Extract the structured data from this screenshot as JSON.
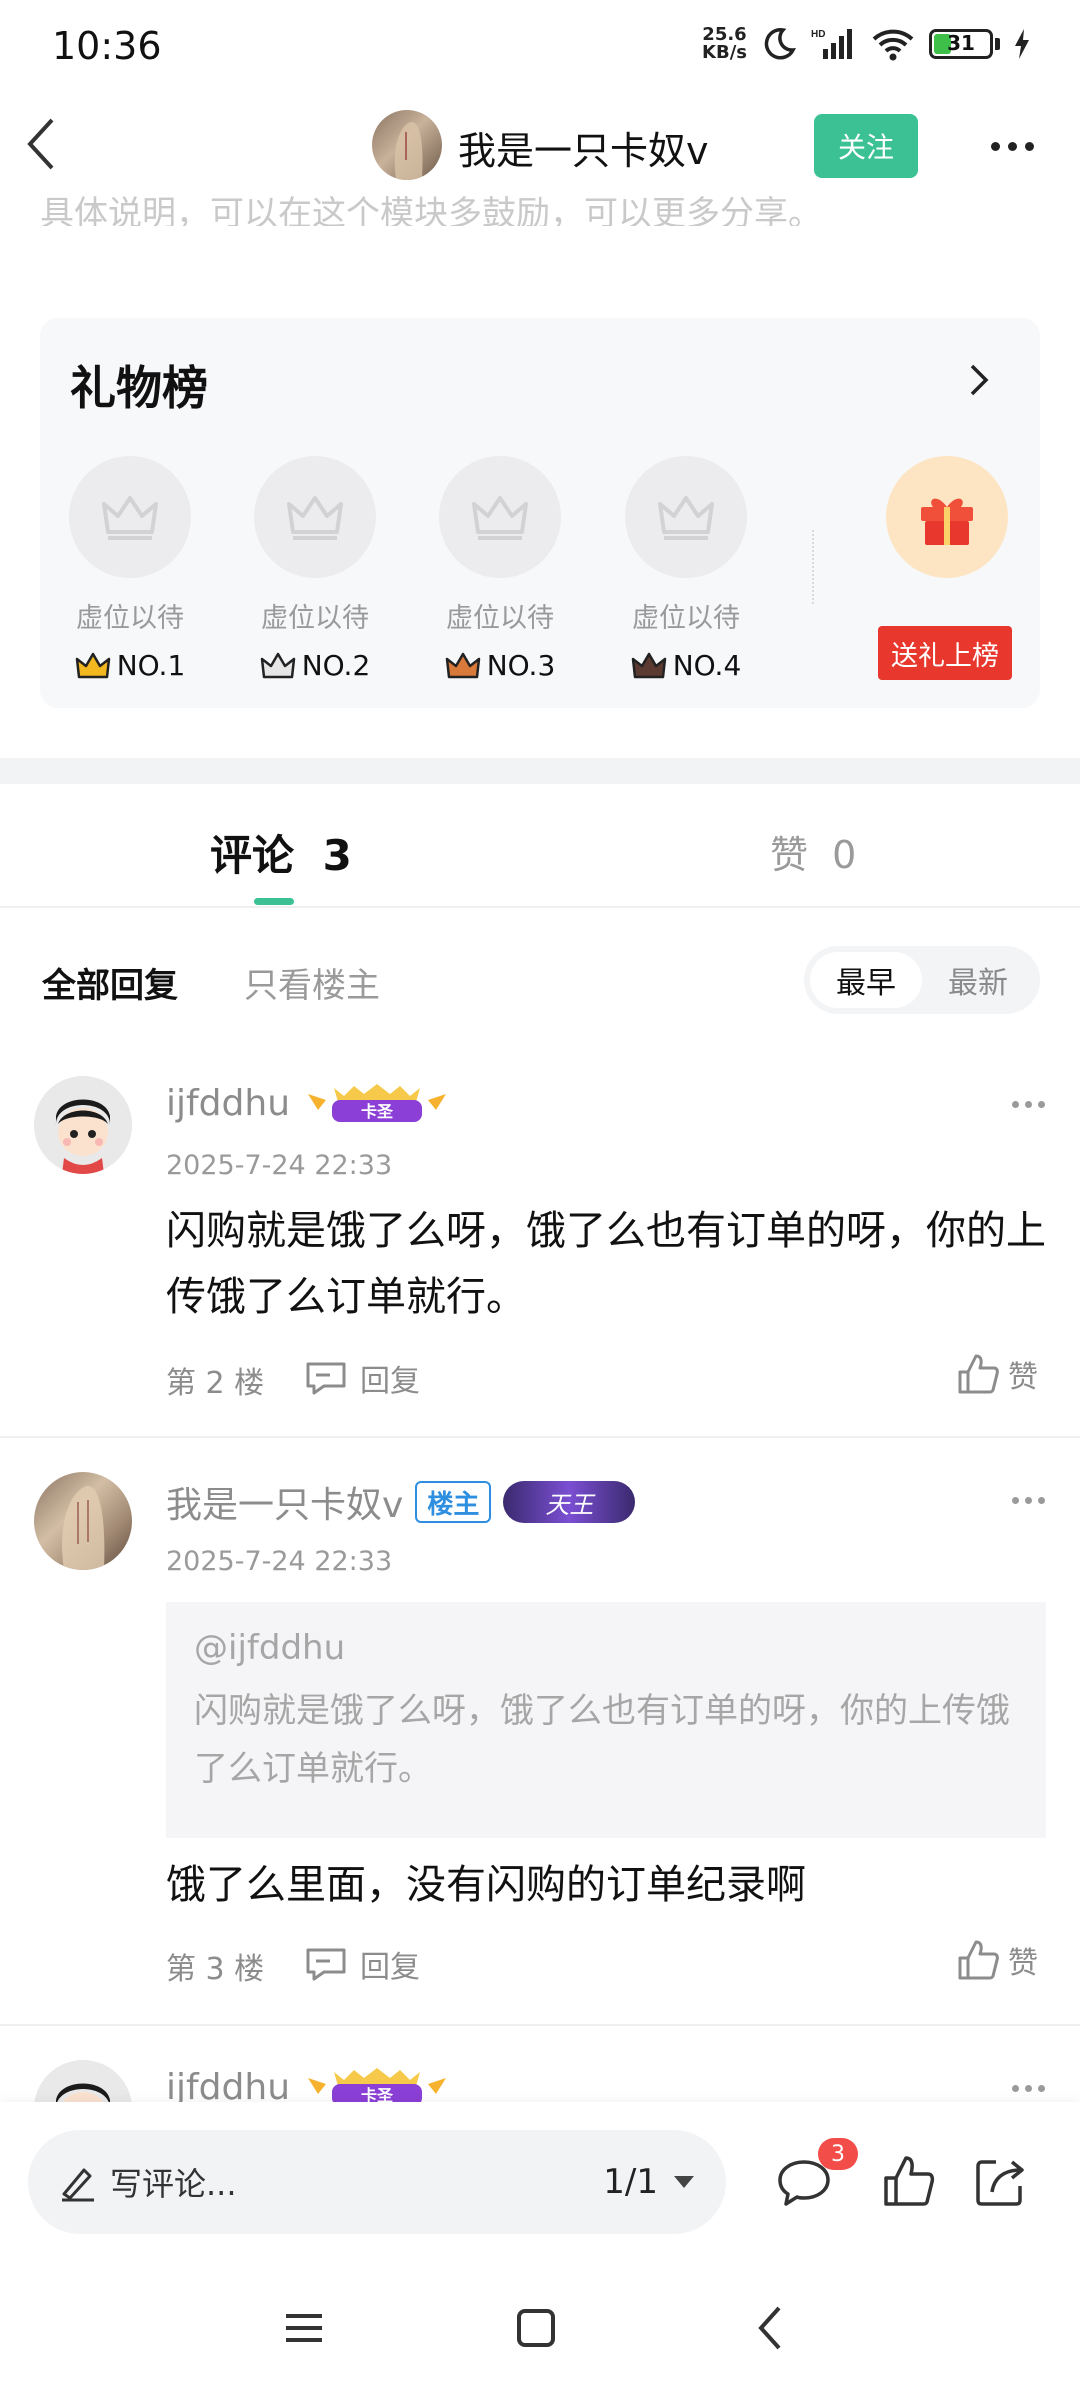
{
  "status_bar": {
    "time": "10:36",
    "net_speed_value": "25.6",
    "net_speed_unit": "KB/s",
    "battery": "31",
    "battery_level": 0.31
  },
  "header": {
    "author_name": "我是一只卡奴v",
    "follow_label": "关注"
  },
  "faded_text": "具体说明，可以在这个模块多鼓励，可以更多分享。",
  "gift_board": {
    "title": "礼物榜",
    "slots": [
      {
        "label": "虚位以待",
        "rank": "NO.1",
        "crown_color": "#f3b81f"
      },
      {
        "label": "虚位以待",
        "rank": "NO.2",
        "crown_color": "#c9c9c9"
      },
      {
        "label": "虚位以待",
        "rank": "NO.3",
        "crown_color": "#d9793a"
      },
      {
        "label": "虚位以待",
        "rank": "NO.4",
        "crown_color": "#5b3a32"
      }
    ],
    "send_gift_label": "送礼上榜"
  },
  "tabs": {
    "comments_label": "评论",
    "comments_count": "3",
    "likes_label": "赞",
    "likes_count": "0"
  },
  "filters": {
    "all_label": "全部回复",
    "op_only_label": "只看楼主",
    "sort_earliest": "最早",
    "sort_latest": "最新"
  },
  "comments": [
    {
      "user": "ijfddhu",
      "badge": "卡圣",
      "time": "2025-7-24 22:33",
      "text": "闪购就是饿了么呀，饿了么也有订单的呀，你的上传饿了么订单就行。",
      "floor": "第 2 楼",
      "reply_label": "回复",
      "like_label": "赞"
    },
    {
      "user": "我是一只卡奴v",
      "owner_badge": "楼主",
      "badge": "天王",
      "time": "2025-7-24 22:33",
      "quote_user": "@ijfddhu",
      "quote_text": "闪购就是饿了么呀，饿了么也有订单的呀，你的上传饿了么订单就行。",
      "text": "饿了么里面，没有闪购的订单纪录啊",
      "floor": "第 3 楼",
      "reply_label": "回复",
      "like_label": "赞"
    },
    {
      "user": "ijfddhu",
      "badge": "卡圣"
    }
  ],
  "bottom_bar": {
    "input_placeholder": "写评论...",
    "page_indicator": "1/1",
    "comment_badge": "3"
  },
  "colors": {
    "accent": "#3cc195",
    "gift_red": "#e8372d",
    "badge_red": "#f34d4a"
  }
}
